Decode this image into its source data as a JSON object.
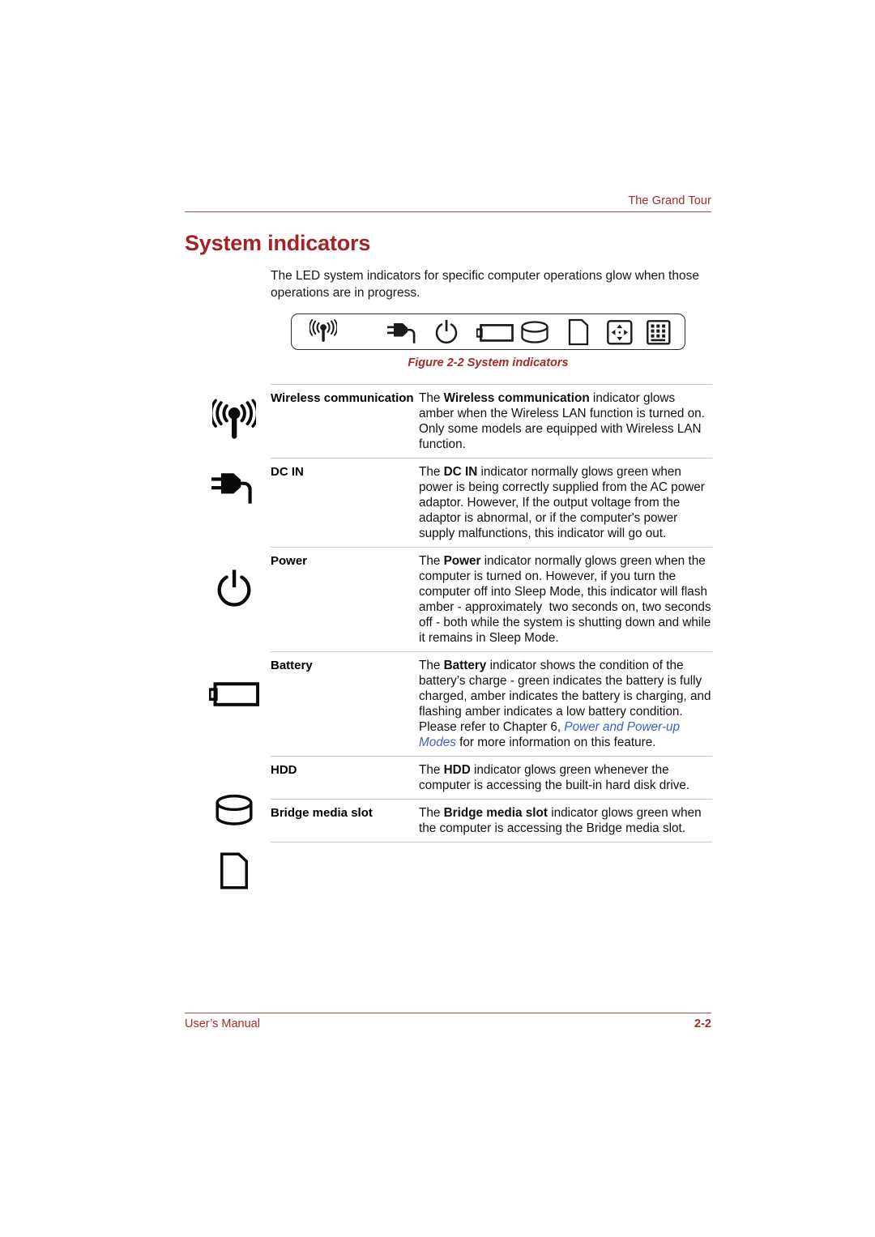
{
  "header": {
    "running_head": "The Grand Tour",
    "accent_color": "#a32a2f"
  },
  "title": "System indicators",
  "intro": "The LED system indicators for specific computer operations glow when those operations are in progress.",
  "figure": {
    "caption": "Figure 2-2 System indicators",
    "icons": [
      "wireless-icon",
      "dc-in-plug-icon",
      "power-icon",
      "battery-icon",
      "hdd-icon",
      "bridge-media-slot-icon",
      "arrow-pad-icon",
      "keypad-icon"
    ]
  },
  "table": {
    "rows": [
      {
        "icon": "wireless-icon",
        "name": "Wireless communication",
        "desc_parts": [
          {
            "t": "The ",
            "style": "normal"
          },
          {
            "t": "Wireless communication",
            "style": "bold"
          },
          {
            "t": " indicator glows amber when the Wireless LAN function is turned on. Only some models are equipped with Wireless LAN function.",
            "style": "normal"
          }
        ],
        "desc": "The Wireless communication indicator glows amber when the Wireless LAN function is turned on. Only some models are equipped with Wireless LAN function."
      },
      {
        "icon": "dc-in-plug-icon",
        "name": "DC IN",
        "desc_parts": [
          {
            "t": "The ",
            "style": "normal"
          },
          {
            "t": "DC IN",
            "style": "bold"
          },
          {
            "t": " indicator normally glows green when power is being correctly supplied from the AC power adaptor. However, If the output voltage from the adaptor is abnormal, or if the computer's power supply malfunctions, this indicator will go out.",
            "style": "normal"
          }
        ],
        "desc": "The DC IN indicator normally glows green when power is being correctly supplied from the AC power adaptor. However, If the output voltage from the adaptor is abnormal, or if the computer's power supply malfunctions, this indicator will go out."
      },
      {
        "icon": "power-icon",
        "name": "Power",
        "desc_parts": [
          {
            "t": "The ",
            "style": "normal"
          },
          {
            "t": "Power",
            "style": "bold"
          },
          {
            "t": " indicator normally glows green when the computer is turned on. However, if you turn the computer off into Sleep Mode, this indicator will flash amber - approximately  two seconds on, two seconds off - both while the system is shutting down and while it remains in Sleep Mode.",
            "style": "normal"
          }
        ],
        "desc": "The Power indicator normally glows green when the computer is turned on. However, if you turn the computer off into Sleep Mode, this indicator will flash amber - approximately two seconds on, two seconds off - both while the system is shutting down and while it remains in Sleep Mode."
      },
      {
        "icon": "battery-icon",
        "name": "Battery",
        "desc_parts": [
          {
            "t": "The ",
            "style": "normal"
          },
          {
            "t": "Battery",
            "style": "bold"
          },
          {
            "t": " indicator shows the condition of the battery’s charge - green indicates the battery is fully charged, amber indicates the battery is charging, and flashing amber indicates a low battery condition. Please refer to Chapter 6, ",
            "style": "normal"
          },
          {
            "t": "Power and Power-up Modes",
            "style": "link"
          },
          {
            "t": " for more information on this feature.",
            "style": "normal"
          }
        ],
        "desc": "The Battery indicator shows the condition of the battery’s charge - green indicates the battery is fully charged, amber indicates the battery is charging, and flashing amber indicates a low battery condition. Please refer to Chapter 6, Power and Power-up Modes for more information on this feature."
      },
      {
        "icon": "hdd-icon",
        "name": "HDD",
        "desc_parts": [
          {
            "t": "The ",
            "style": "normal"
          },
          {
            "t": "HDD",
            "style": "bold"
          },
          {
            "t": " indicator glows green whenever the computer is accessing the built-in hard disk drive.",
            "style": "normal"
          }
        ],
        "desc": "The HDD indicator glows green whenever the computer is accessing the built-in hard disk drive."
      },
      {
        "icon": "bridge-media-slot-icon",
        "name": "Bridge media slot",
        "desc_parts": [
          {
            "t": "The ",
            "style": "normal"
          },
          {
            "t": "Bridge media slot",
            "style": "bold"
          },
          {
            "t": " indicator glows green when the computer is accessing the Bridge media slot.",
            "style": "normal"
          }
        ],
        "desc": "The Bridge media slot indicator glows green when the computer is accessing the Bridge media slot."
      }
    ]
  },
  "footer": {
    "manual_label": "User’s Manual",
    "page_number": "2-2"
  },
  "colors": {
    "accent_red": "#a32a2f",
    "title_red": "#a32228",
    "link_blue": "#3d5ec4",
    "rule_gray": "#c9c9c9"
  }
}
